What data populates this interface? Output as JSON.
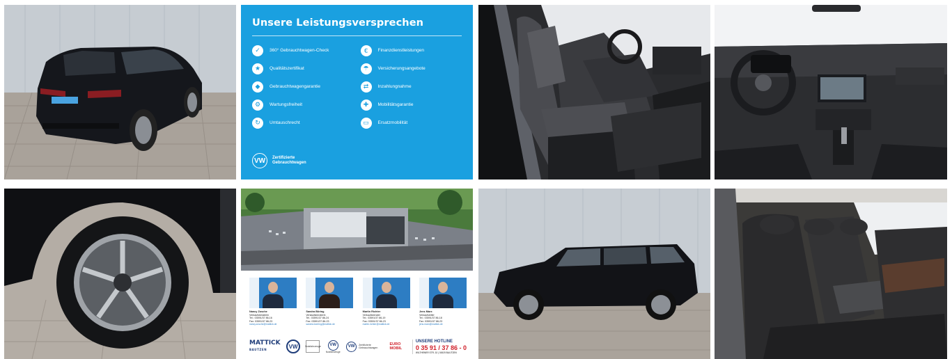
{
  "gallery": {
    "tiles": [
      {
        "name": "photo-rear-exterior"
      },
      {
        "name": "promise-panel"
      },
      {
        "name": "photo-front-seats"
      },
      {
        "name": "photo-dashboard"
      },
      {
        "name": "photo-wheel"
      },
      {
        "name": "dealer-panel"
      },
      {
        "name": "photo-side-exterior"
      },
      {
        "name": "photo-rear-seats"
      }
    ]
  },
  "promise": {
    "title": "Unsere Leistungsversprechen",
    "items": [
      {
        "label": "360° Gebrauchtwagen-Check",
        "icon": "check-icon"
      },
      {
        "label": "Finanzdienstleistungen",
        "icon": "finance-icon"
      },
      {
        "label": "Qualitätszertifikat",
        "icon": "certificate-icon"
      },
      {
        "label": "Versicherungsangebote",
        "icon": "insurance-icon"
      },
      {
        "label": "Gebrauchtwagengarantie",
        "icon": "shield-icon"
      },
      {
        "label": "Inzahlungnahme",
        "icon": "tradein-icon"
      },
      {
        "label": "Wartungsfreiheit",
        "icon": "wrench-icon"
      },
      {
        "label": "Mobilitätsgarantie",
        "icon": "mobility-icon"
      },
      {
        "label": "Umtauschrecht",
        "icon": "exchange-icon"
      },
      {
        "label": "Ersatzmobilität",
        "icon": "car-icon"
      }
    ],
    "footer": "Zertifizierte Gebrauchtwagen",
    "brand_color": "#1aa0e0"
  },
  "dealer": {
    "staff": [
      {
        "name": "Nancy Zosche",
        "role": "Verkaufsberaterin",
        "phone": "Tel.: 03591/37 86-16",
        "fax": "Fax: 03591/37 86-23",
        "email": "nancy.zosche@mattick.de"
      },
      {
        "name": "Sandra Böring",
        "role": "Verkaufsberaterin",
        "phone": "Tel.: 03591/37 86-24",
        "fax": "Fax: 03591/37 86-23",
        "email": "sandra.boering@mattick.de"
      },
      {
        "name": "Martin Richter",
        "role": "Verkaufsberater",
        "phone": "Tel.: 03591/37 86-19",
        "fax": "Fax: 03591/37 86-23",
        "email": "martin.richter@mattick.de"
      },
      {
        "name": "Jens Marx",
        "role": "Verkaufsleiter",
        "phone": "Tel.: 03591/37 86-18",
        "fax": "Fax: 03591/37 86-23",
        "email": "jens.marx@mattick.de"
      }
    ],
    "logo_name": "MATTICK",
    "logo_city": "BAUTZEN",
    "nf_badge": "Nutzfahrzeuge",
    "vw_small_caption": "Nutzfahrzeuge",
    "cert_text": "Zertifizierte Gebrauchtwagen",
    "euro_logo": "EURO MOBIL",
    "hotline_label": "UNSERE HOTLINE",
    "hotline_number": "0 35 91 / 37 86 - 0",
    "hotline_address": "WILTHENER STR. 32 | 02625 BAUTZEN"
  }
}
